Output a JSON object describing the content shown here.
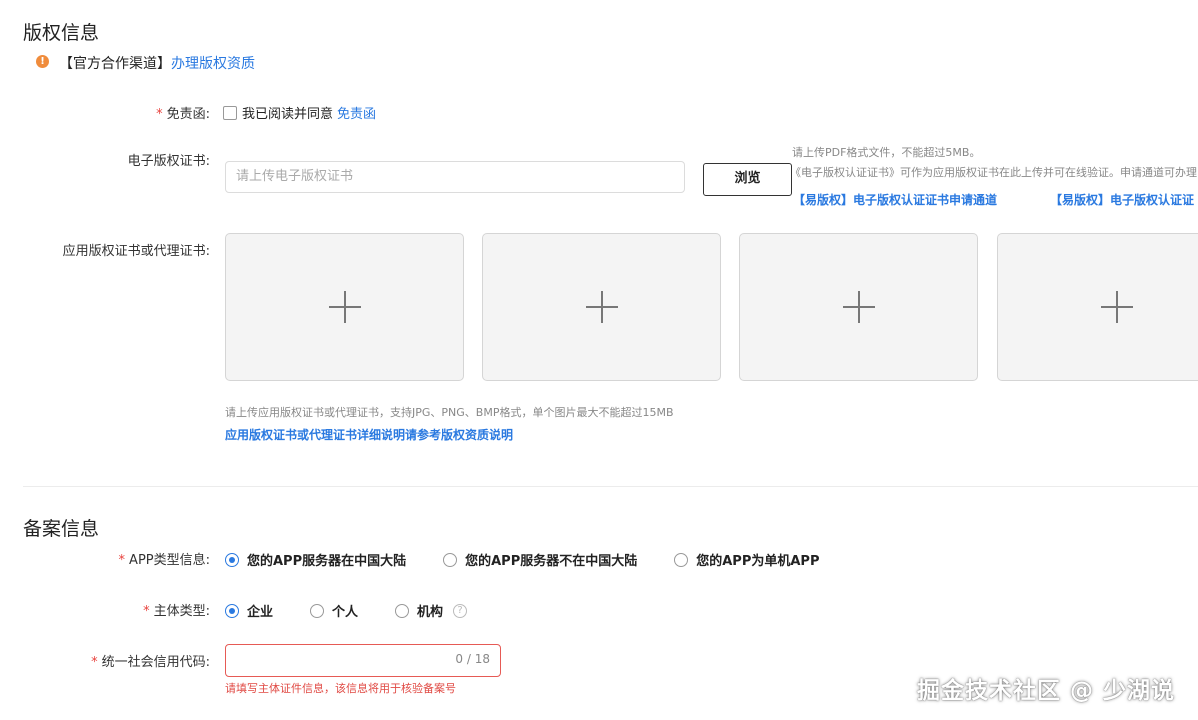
{
  "copyright": {
    "title": "版权信息",
    "notice_prefix": "【官方合作渠道】",
    "notice_link": "办理版权资质",
    "disclaimer": {
      "label": "免责函:",
      "checkbox_text": "我已阅读并同意",
      "link": "免责函"
    },
    "ecert": {
      "label": "电子版权证书:",
      "placeholder": "请上传电子版权证书",
      "browse_button": "浏览",
      "hint1": "请上传PDF格式文件，不能超过5MB。",
      "hint2": "《电子版权认证证书》可作为应用版权证书在此上传并可在线验证。申请通道可办理",
      "link1": "【易版权】电子版权认证证书申请通道",
      "link2": "【易版权】电子版权认证证"
    },
    "app_cert": {
      "label": "应用版权证书或代理证书:",
      "hint": "请上传应用版权证书或代理证书，支持JPG、PNG、BMP格式，单个图片最大不能超过15MB",
      "link": "应用版权证书或代理证书详细说明请参考版权资质说明"
    }
  },
  "filing": {
    "title": "备案信息",
    "app_type": {
      "label": "APP类型信息:",
      "options": [
        "您的APP服务器在中国大陆",
        "您的APP服务器不在中国大陆",
        "您的APP为单机APP"
      ]
    },
    "subject_type": {
      "label": "主体类型:",
      "options": [
        "企业",
        "个人",
        "机构"
      ]
    },
    "credit_code": {
      "label": "统一社会信用代码:",
      "counter": "0 / 18",
      "error": "请填写主体证件信息，该信息将用于核验备案号"
    }
  },
  "watermark": "掘金技术社区 @ 少湖说",
  "colors": {
    "accent": "#2a79e0",
    "error": "#e04a44",
    "warning": "#f08c3c"
  }
}
